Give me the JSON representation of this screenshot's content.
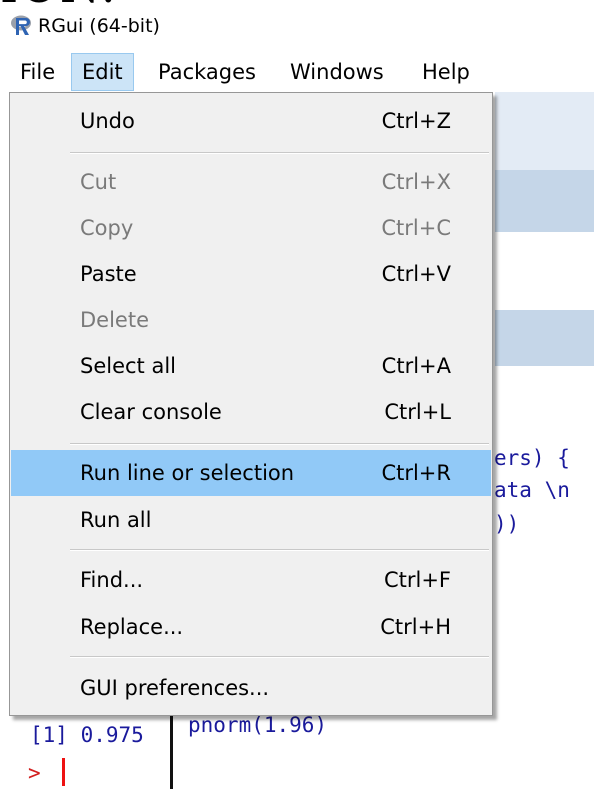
{
  "cut_text": "ION:",
  "window": {
    "title": "RGui (64-bit)"
  },
  "menubar": [
    {
      "label": "File"
    },
    {
      "label": "Edit"
    },
    {
      "label": "Packages"
    },
    {
      "label": "Windows"
    },
    {
      "label": "Help"
    }
  ],
  "edit_menu": [
    {
      "label": "Undo",
      "shortcut": "Ctrl+Z",
      "enabled": true
    },
    {
      "label": "Cut",
      "shortcut": "Ctrl+X",
      "enabled": false
    },
    {
      "label": "Copy",
      "shortcut": "Ctrl+C",
      "enabled": false
    },
    {
      "label": "Paste",
      "shortcut": "Ctrl+V",
      "enabled": true
    },
    {
      "label": "Delete",
      "shortcut": "",
      "enabled": false
    },
    {
      "label": "Select all",
      "shortcut": "Ctrl+A",
      "enabled": true
    },
    {
      "label": "Clear console",
      "shortcut": "Ctrl+L",
      "enabled": true
    },
    {
      "label": "Run line or selection",
      "shortcut": "Ctrl+R",
      "enabled": true,
      "highlighted": true
    },
    {
      "label": "Run all",
      "shortcut": "",
      "enabled": true
    },
    {
      "label": "Find...",
      "shortcut": "Ctrl+F",
      "enabled": true
    },
    {
      "label": "Replace...",
      "shortcut": "Ctrl+H",
      "enabled": true
    },
    {
      "label": "GUI preferences...",
      "shortcut": "",
      "enabled": true
    }
  ],
  "editor_fragments": {
    "line1": "ers) {",
    "line2": "ata \\n",
    "line3": "))",
    "command": "pnorm(1.96)"
  },
  "console": {
    "output": "[1] 0.975",
    "prompt": ">"
  },
  "colors": {
    "highlight": "#91c9f7",
    "menu_bg": "#f0f0f0",
    "active_menu": "#cce4f7",
    "console_text": "#1a1a9c",
    "prompt": "#d21f1f"
  }
}
